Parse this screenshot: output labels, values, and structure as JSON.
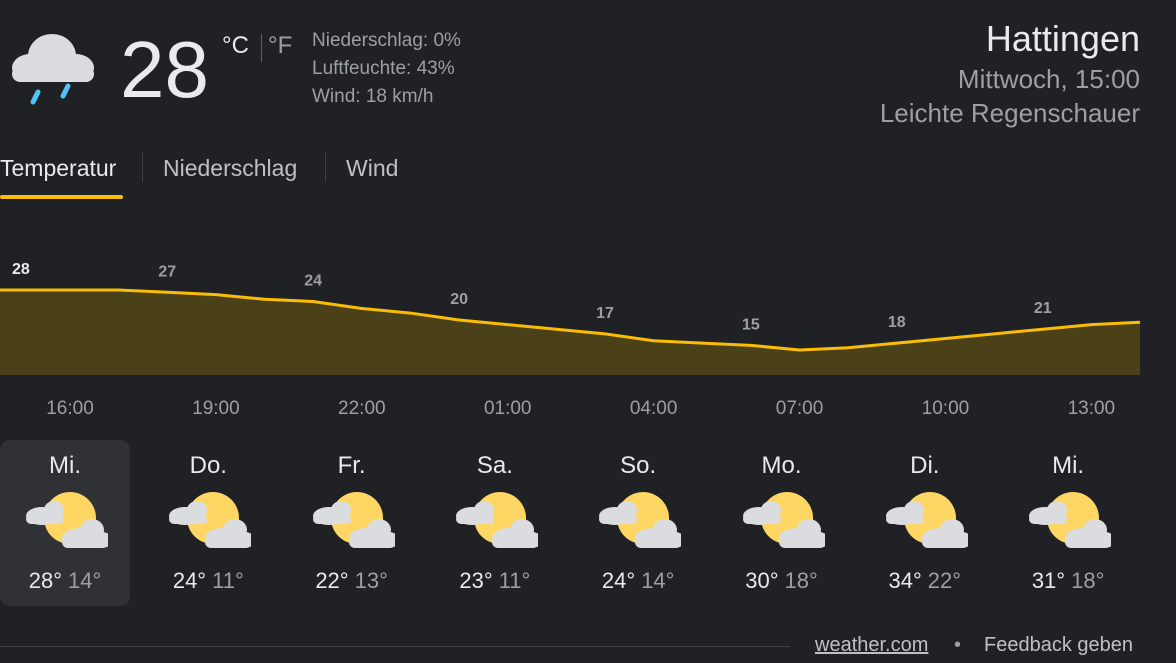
{
  "current": {
    "icon": "rain-cloud-icon",
    "temp": "28",
    "unit_c": "°C",
    "unit_f": "°F",
    "precip": "Niederschlag: 0%",
    "humidity": "Luftfeuchte: 43%",
    "wind": "Wind: 18 km/h"
  },
  "location": "Hattingen",
  "datetime": "Mittwoch, 15:00",
  "condition": "Leichte Regenschauer",
  "tabs": [
    "Temperatur",
    "Niederschlag",
    "Wind"
  ],
  "colors": {
    "accent": "#fbbc04",
    "area_fill": "#4b4119",
    "background": "#202124"
  },
  "chart_data": {
    "type": "area",
    "x": [
      "15:00",
      "16:00",
      "17:00",
      "18:00",
      "19:00",
      "20:00",
      "21:00",
      "22:00",
      "23:00",
      "00:00",
      "01:00",
      "02:00",
      "03:00",
      "04:00",
      "05:00",
      "06:00",
      "07:00",
      "08:00",
      "09:00",
      "10:00",
      "11:00",
      "12:00",
      "13:00",
      "14:00"
    ],
    "values": [
      28,
      28,
      28,
      27.5,
      27,
      26,
      25.5,
      24,
      23,
      21.5,
      20.5,
      19.5,
      18.5,
      17,
      16.5,
      16,
      15,
      15.5,
      16.5,
      17.5,
      18.5,
      19.5,
      20.5,
      21
    ],
    "labels": [
      {
        "x": "15:00",
        "value": "28"
      },
      {
        "x": "18:00",
        "value": "27"
      },
      {
        "x": "21:00",
        "value": "24"
      },
      {
        "x": "00:00",
        "value": "20"
      },
      {
        "x": "03:00",
        "value": "17"
      },
      {
        "x": "06:00",
        "value": "15"
      },
      {
        "x": "09:00",
        "value": "18"
      },
      {
        "x": "12:00",
        "value": "21"
      }
    ],
    "tick_labels": [
      "16:00",
      "19:00",
      "22:00",
      "01:00",
      "04:00",
      "07:00",
      "10:00",
      "13:00"
    ],
    "ylim": [
      0,
      30
    ],
    "grid": false
  },
  "days": [
    {
      "name": "Mi.",
      "hi": "28°",
      "lo": "14°",
      "icon": "partly-cloudy-icon",
      "selected": true
    },
    {
      "name": "Do.",
      "hi": "24°",
      "lo": "11°",
      "icon": "partly-cloudy-icon"
    },
    {
      "name": "Fr.",
      "hi": "22°",
      "lo": "13°",
      "icon": "partly-cloudy-icon"
    },
    {
      "name": "Sa.",
      "hi": "23°",
      "lo": "11°",
      "icon": "partly-cloudy-icon"
    },
    {
      "name": "So.",
      "hi": "24°",
      "lo": "14°",
      "icon": "partly-cloudy-icon"
    },
    {
      "name": "Mo.",
      "hi": "30°",
      "lo": "18°",
      "icon": "partly-cloudy-icon"
    },
    {
      "name": "Di.",
      "hi": "34°",
      "lo": "22°",
      "icon": "partly-cloudy-icon"
    },
    {
      "name": "Mi.",
      "hi": "31°",
      "lo": "18°",
      "icon": "partly-cloudy-icon"
    }
  ],
  "footer": {
    "source": "weather.com",
    "separator": "•",
    "feedback": "Feedback geben"
  }
}
